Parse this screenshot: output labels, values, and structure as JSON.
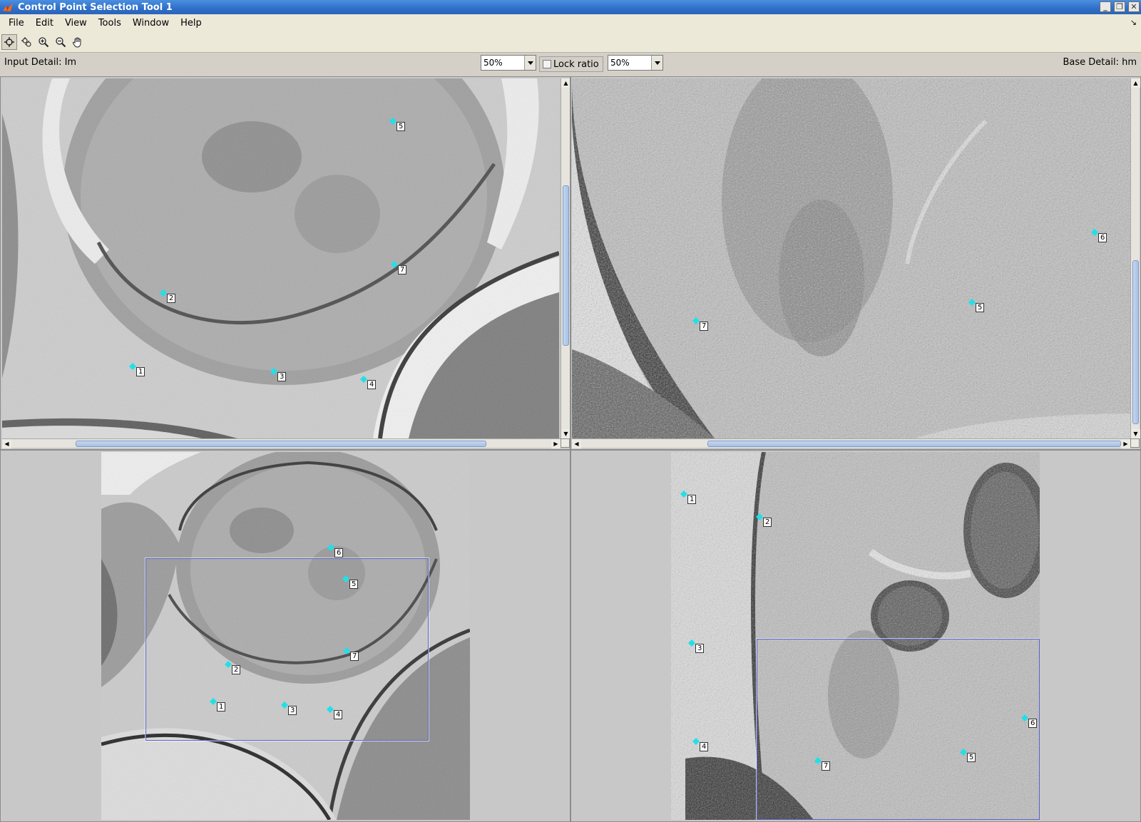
{
  "window": {
    "title": "Control Point Selection Tool 1",
    "buttons": [
      "_",
      "❐",
      "✕"
    ]
  },
  "menu": {
    "items": [
      "File",
      "Edit",
      "View",
      "Tools",
      "Window",
      "Help"
    ],
    "dock": "↘"
  },
  "toolbar": {
    "tools": [
      "add-point",
      "select-point",
      "zoom-in",
      "zoom-out",
      "pan"
    ]
  },
  "detail": {
    "input_label": "Input Detail: Im",
    "base_label": "Base Detail: hm",
    "input_zoom": "50%",
    "base_zoom": "50%",
    "lock_ratio": "Lock ratio",
    "lock_ratio_checked": false
  },
  "colors": {
    "point": "#20e0e8",
    "roi": "#5a62c8"
  },
  "points": {
    "input_detail": [
      "5",
      "7",
      "2",
      "1",
      "3",
      "4"
    ],
    "base_detail": [
      "6",
      "5",
      "7"
    ],
    "input_overview": [
      "6",
      "5",
      "7",
      "2",
      "1",
      "3",
      "4"
    ],
    "base_overview": [
      "1",
      "2",
      "3",
      "4",
      "7",
      "5",
      "6"
    ]
  }
}
